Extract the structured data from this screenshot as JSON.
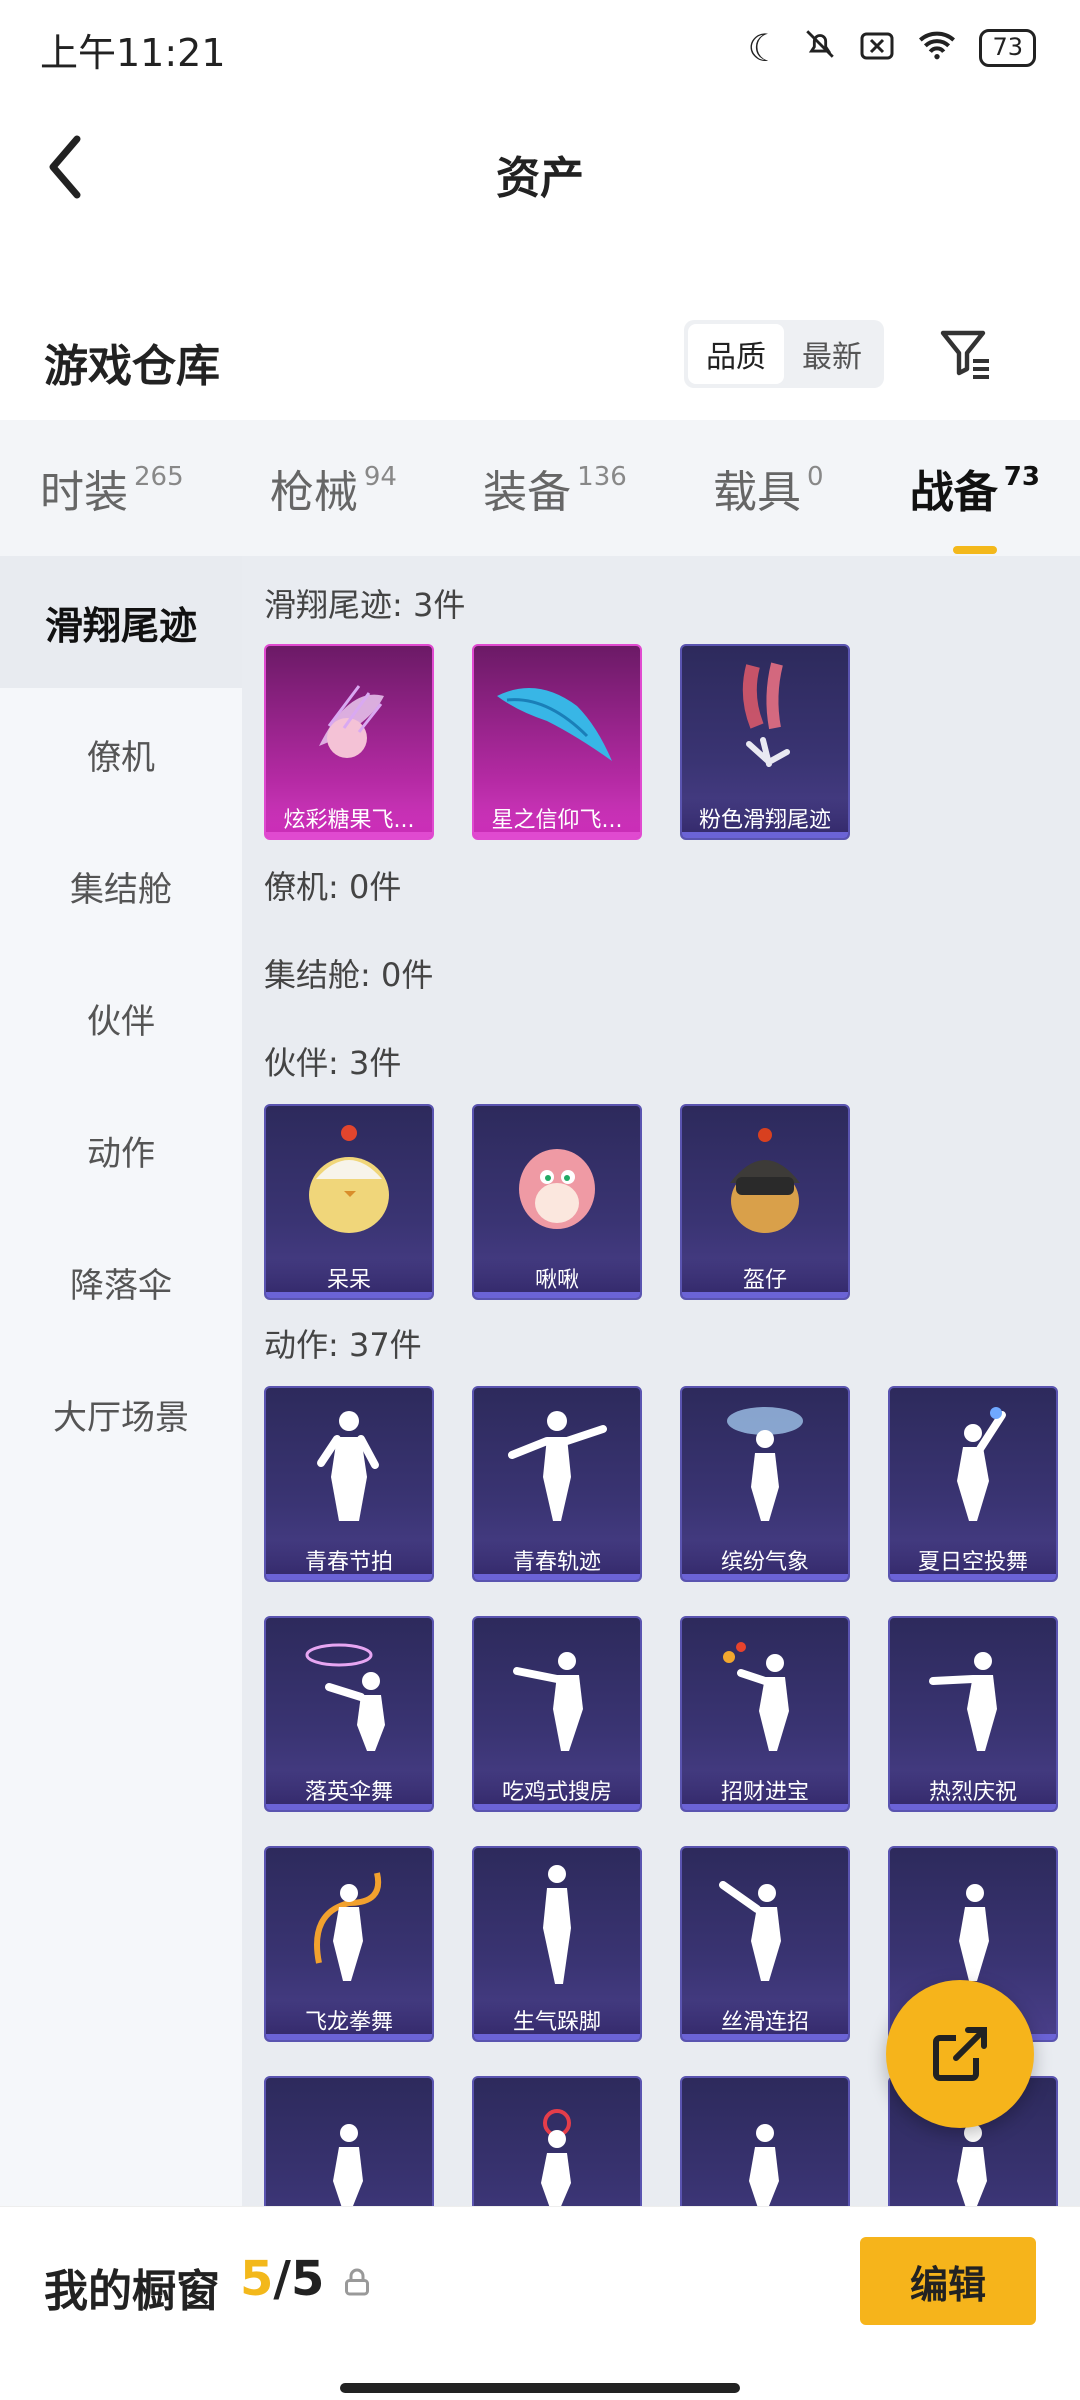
{
  "status": {
    "time": "上午11:21",
    "battery": "73",
    "icons": [
      "moon-icon",
      "mute-icon",
      "sim-x-icon",
      "wifi-icon",
      "battery-icon"
    ]
  },
  "header": {
    "back_label": "‹",
    "title": "资产"
  },
  "warehouse": {
    "title": "游戏仓库",
    "sort_options": [
      "品质",
      "最新"
    ],
    "sort_selected": "品质"
  },
  "tabs": [
    {
      "label": "时装",
      "count": "265",
      "active": false
    },
    {
      "label": "枪械",
      "count": "94",
      "active": false
    },
    {
      "label": "装备",
      "count": "136",
      "active": false
    },
    {
      "label": "载具",
      "count": "0",
      "active": false
    },
    {
      "label": "战备",
      "count": "73",
      "active": true
    }
  ],
  "sidebar": [
    {
      "label": "滑翔尾迹",
      "active": true
    },
    {
      "label": "僚机",
      "active": false
    },
    {
      "label": "集结舱",
      "active": false
    },
    {
      "label": "伙伴",
      "active": false
    },
    {
      "label": "动作",
      "active": false
    },
    {
      "label": "降落伞",
      "active": false
    },
    {
      "label": "大厅场景",
      "active": false
    }
  ],
  "sections": {
    "glide": {
      "title": "滑翔尾迹: 3件",
      "items": [
        "炫彩糖果飞...",
        "星之信仰飞...",
        "粉色滑翔尾迹"
      ]
    },
    "wingman": {
      "title": "僚机: 0件"
    },
    "capsule": {
      "title": "集结舱: 0件"
    },
    "partner": {
      "title": "伙伴: 3件",
      "items": [
        "呆呆",
        "啾啾",
        "盔仔"
      ]
    },
    "action": {
      "title": "动作: 37件",
      "items": [
        "青春节拍",
        "青春轨迹",
        "缤纷气象",
        "夏日空投舞",
        "落英伞舞",
        "吃鸡式搜房",
        "招财进宝",
        "热烈庆祝",
        "飞龙拳舞",
        "生气跺脚",
        "丝滑连招"
      ]
    }
  },
  "bottom": {
    "label": "我的橱窗",
    "count_current": "5",
    "count_sep_total": "/5",
    "edit_label": "编辑"
  },
  "colors": {
    "accent": "#f6b41b",
    "card": "#3a3473",
    "card_pink": "#c42fb2"
  }
}
